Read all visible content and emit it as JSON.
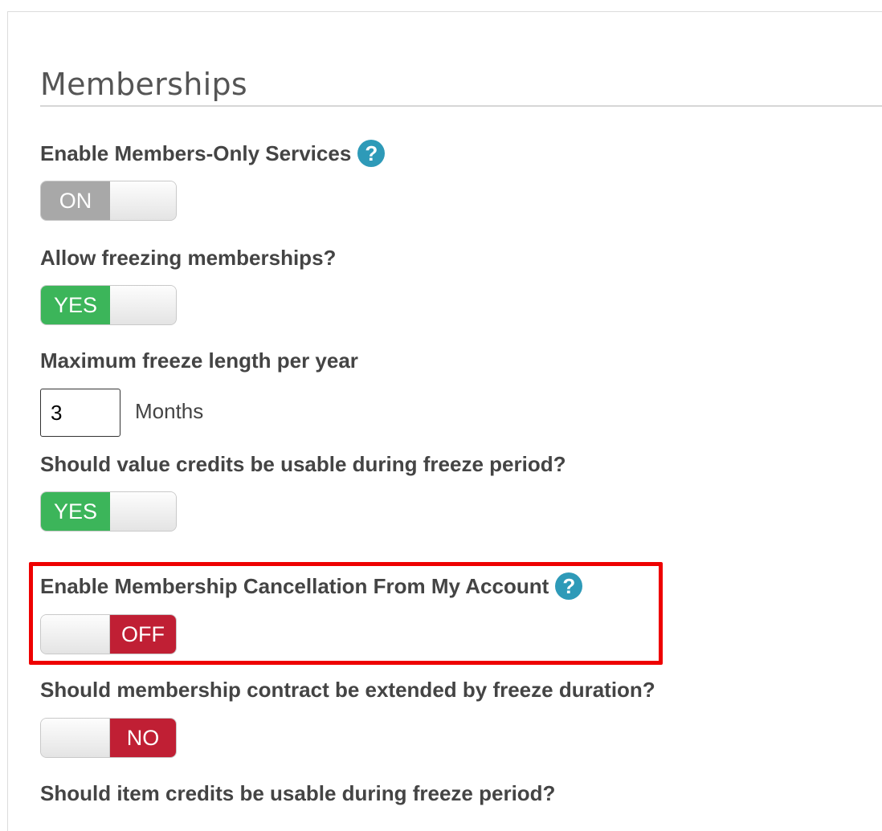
{
  "page": {
    "title": "Memberships"
  },
  "settings": {
    "members_only": {
      "label": "Enable Members-Only Services",
      "help_icon": "?",
      "toggle_value": "ON",
      "toggle_color": "#a8a8a8"
    },
    "allow_freezing": {
      "label": "Allow freezing memberships?",
      "toggle_value": "YES",
      "toggle_color": "#3cb55a"
    },
    "max_freeze": {
      "label": "Maximum freeze length per year",
      "value": "3",
      "unit": "Months"
    },
    "value_credits_freeze": {
      "label": "Should value credits be usable during freeze period?",
      "toggle_value": "YES",
      "toggle_color": "#3cb55a"
    },
    "cancellation_my_account": {
      "label": "Enable Membership Cancellation From My Account",
      "help_icon": "?",
      "toggle_value": "OFF",
      "toggle_color": "#c01f34",
      "highlight_color": "#ee0000"
    },
    "extend_contract": {
      "label": "Should membership contract be extended by freeze duration?",
      "toggle_value": "NO",
      "toggle_color": "#c01f34"
    },
    "item_credits_freeze": {
      "label": "Should item credits be usable during freeze period?"
    }
  }
}
